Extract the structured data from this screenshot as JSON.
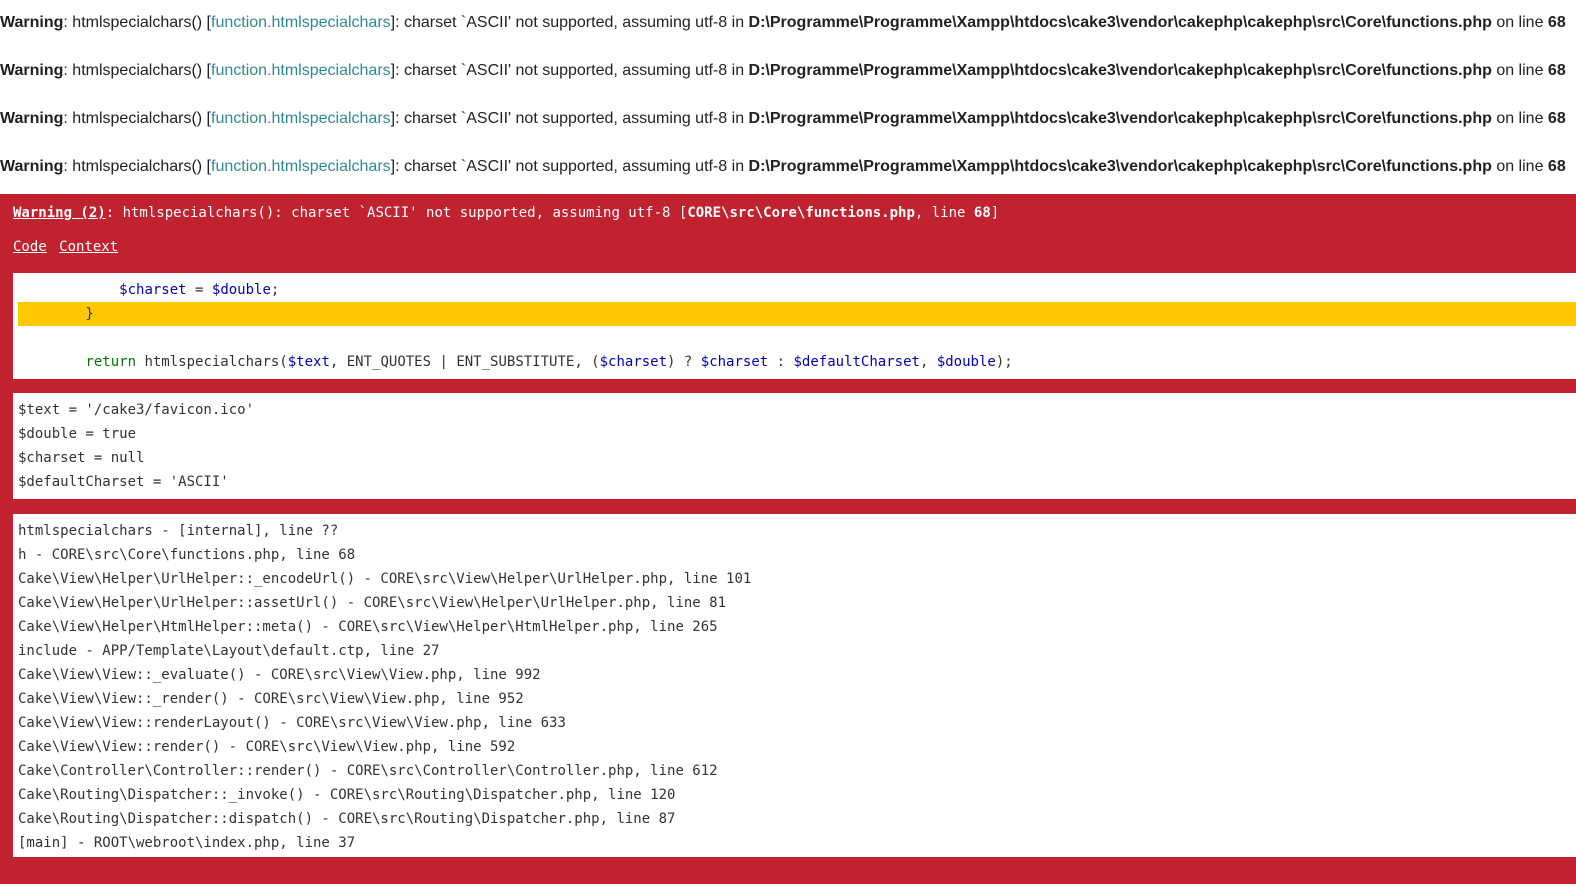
{
  "php_warnings": [
    {
      "label": "Warning",
      "func": "htmlspecialchars()",
      "doc_link": "function.htmlspecialchars",
      "message": "charset `ASCII' not supported, assuming utf-8 in",
      "file": "D:\\Programme\\Programme\\Xampp\\htdocs\\cake3\\vendor\\cakephp\\cakephp\\src\\Core\\functions.php",
      "on_line_text": "on line",
      "line": "68"
    },
    {
      "label": "Warning",
      "func": "htmlspecialchars()",
      "doc_link": "function.htmlspecialchars",
      "message": "charset `ASCII' not supported, assuming utf-8 in",
      "file": "D:\\Programme\\Programme\\Xampp\\htdocs\\cake3\\vendor\\cakephp\\cakephp\\src\\Core\\functions.php",
      "on_line_text": "on line",
      "line": "68"
    },
    {
      "label": "Warning",
      "func": "htmlspecialchars()",
      "doc_link": "function.htmlspecialchars",
      "message": "charset `ASCII' not supported, assuming utf-8 in",
      "file": "D:\\Programme\\Programme\\Xampp\\htdocs\\cake3\\vendor\\cakephp\\cakephp\\src\\Core\\functions.php",
      "on_line_text": "on line",
      "line": "68"
    },
    {
      "label": "Warning",
      "func": "htmlspecialchars()",
      "doc_link": "function.htmlspecialchars",
      "message": "charset `ASCII' not supported, assuming utf-8 in",
      "file": "D:\\Programme\\Programme\\Xampp\\htdocs\\cake3\\vendor\\cakephp\\cakephp\\src\\Core\\functions.php",
      "on_line_text": "on line",
      "line": "68"
    }
  ],
  "cake_error": {
    "level_link": "Warning (2)",
    "message": ": htmlspecialchars(): charset `ASCII' not supported, assuming utf-8 [",
    "file": "CORE\\src\\Core\\functions.php",
    "line_prefix": ", line ",
    "line": "68",
    "close": "]",
    "links": {
      "code": "Code",
      "context": "Context"
    },
    "code_lines": [
      {
        "text": "            $charset = $double;",
        "highlighted": false
      },
      {
        "text": "        }",
        "highlighted": true
      },
      {
        "text": "",
        "highlighted": false
      },
      {
        "text": "        return htmlspecialchars($text, ENT_QUOTES | ENT_SUBSTITUTE, ($charset) ? $charset : $defaultCharset, $double);",
        "highlighted": false
      }
    ],
    "context_lines": [
      "$text = '/cake3/favicon.ico'",
      "$double = true",
      "$charset = null",
      "$defaultCharset = 'ASCII'"
    ],
    "trace_lines": [
      "htmlspecialchars - [internal], line ??",
      "h - CORE\\src\\Core\\functions.php, line 68",
      "Cake\\View\\Helper\\UrlHelper::_encodeUrl() - CORE\\src\\View\\Helper\\UrlHelper.php, line 101",
      "Cake\\View\\Helper\\UrlHelper::assetUrl() - CORE\\src\\View\\Helper\\UrlHelper.php, line 81",
      "Cake\\View\\Helper\\HtmlHelper::meta() - CORE\\src\\View\\Helper\\HtmlHelper.php, line 265",
      "include - APP/Template\\Layout\\default.ctp, line 27",
      "Cake\\View\\View::_evaluate() - CORE\\src\\View\\View.php, line 992",
      "Cake\\View\\View::_render() - CORE\\src\\View\\View.php, line 952",
      "Cake\\View\\View::renderLayout() - CORE\\src\\View\\View.php, line 633",
      "Cake\\View\\View::render() - CORE\\src\\View\\View.php, line 592",
      "Cake\\Controller\\Controller::render() - CORE\\src\\Controller\\Controller.php, line 612",
      "Cake\\Routing\\Dispatcher::_invoke() - CORE\\src\\Routing\\Dispatcher.php, line 120",
      "Cake\\Routing\\Dispatcher::dispatch() - CORE\\src\\Routing\\Dispatcher.php, line 87",
      "[main] - ROOT\\webroot\\index.php, line 37"
    ]
  },
  "colors": {
    "error_background": "#c12230",
    "highlight": "#ffc800",
    "doc_link": "#2e8b8b",
    "php_keyword": "#007700",
    "php_variable": "#0000bb"
  }
}
